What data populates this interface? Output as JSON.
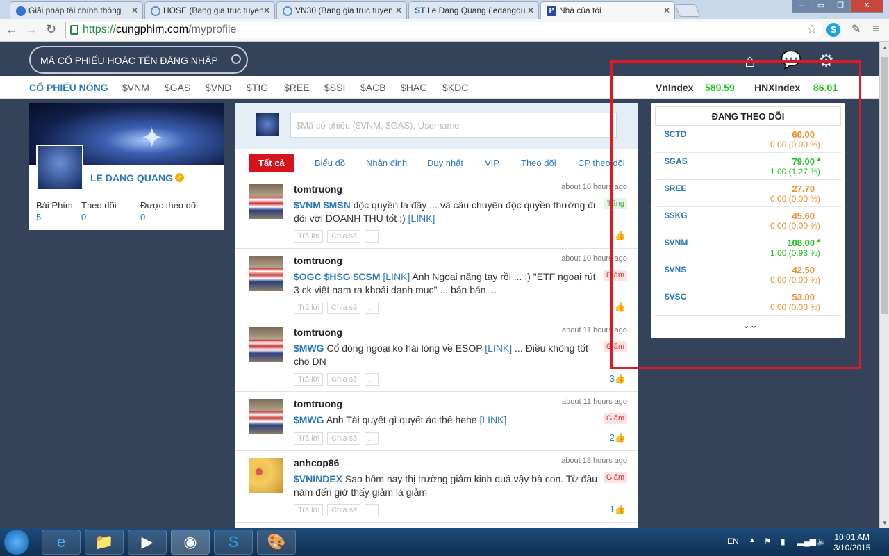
{
  "browser": {
    "tabs": [
      {
        "title": "Giải pháp tài chính thông",
        "icon_color": "#3b6fd6"
      },
      {
        "title": "HOSE (Bang gia truc tuyen",
        "icon_color": "#5a8fd8"
      },
      {
        "title": "VN30 (Bang gia truc tuyen",
        "icon_color": "#5a8fd8"
      },
      {
        "title": "Le Dang Quang (ledangqu",
        "icon_color": "#2a5da8",
        "prefix": "ST"
      },
      {
        "title": "Nhà của tôi",
        "icon_color": "#2a4b9c",
        "prefix": "P"
      }
    ],
    "url_scheme": "https://",
    "url_host": "cungphim.com",
    "url_path": "/myprofile"
  },
  "header": {
    "search_placeholder": "MÃ CỔ PHIẾU HOẶC TÊN ĐĂNG NHẬP",
    "icons": [
      "home-icon",
      "chat-icon",
      "gear-icon"
    ]
  },
  "hot": {
    "label": "CỔ PHIẾU NÓNG",
    "tickers": [
      "$VNM",
      "$GAS",
      "$VND",
      "$TIG",
      "$REE",
      "$SSI",
      "$ACB",
      "$HAG",
      "$KDC"
    ],
    "vnindex_label": "VnIndex",
    "vnindex_value": "589.59",
    "hnx_label": "HNXIndex",
    "hnx_value": "86.01"
  },
  "profile": {
    "name": "LE DANG QUANG",
    "stats": [
      {
        "label": "Bài Phím",
        "value": "5"
      },
      {
        "label": "Theo dõi",
        "value": "0"
      },
      {
        "label": "Được theo dõi",
        "value": "0"
      }
    ]
  },
  "composer": {
    "placeholder": "$Mã cổ phiếu ($VNM, $GAS); Username"
  },
  "filters": [
    "Tất cả",
    "Biểu đồ",
    "Nhận định",
    "Duy nhất",
    "VIP",
    "Theo dõi",
    "CP theo dõi"
  ],
  "post_actions": [
    "Trả lời",
    "Chia sẻ",
    "..."
  ],
  "posts": [
    {
      "user": "tomtruong",
      "time": "about 10 hours ago",
      "tickers": "$VNM $MSN",
      "text": "độc quyền là đây ... và câu chuyện độc quyền thường đi đôi với DOANH THU tốt ;)",
      "link": "[LINK]",
      "suffix": "",
      "badge": "Tăng",
      "likes": "1"
    },
    {
      "user": "tomtruong",
      "time": "about 10 hours ago",
      "tickers": "$OGC $HSG $CSM",
      "text": "",
      "link": "[LINK]",
      "suffix": "Anh Ngoại nặng tay rồi ... ;) \"ETF ngoại rút 3 ck việt nam ra khoải danh mục\" ... bán bán ...",
      "badge": "Giảm",
      "likes": ""
    },
    {
      "user": "tomtruong",
      "time": "about 11 hours ago",
      "tickers": "$MWG",
      "text": "Cổ đông ngoại ko hài lòng về ESOP",
      "link": "[LINK]",
      "suffix": "... Điều không tốt cho DN",
      "badge": "Giảm",
      "likes": "3"
    },
    {
      "user": "tomtruong",
      "time": "about 11 hours ago",
      "tickers": "$MWG",
      "text": "Anh Tài quyết gì quyết ác thế hehe",
      "link": "[LINK]",
      "suffix": "",
      "badge": "Giảm",
      "likes": "2"
    },
    {
      "user": "anhcop86",
      "time": "about 13 hours ago",
      "tickers": "$VNINDEX",
      "text": "Sao hôm nay thị trường giảm kinh quá vậy bà con. Từ đầu năm đến giờ thấy giảm là giảm",
      "link": "",
      "suffix": "",
      "badge": "Giảm",
      "likes": "1"
    }
  ],
  "watchlist": {
    "title": "ĐANG THEO DÕI",
    "rows": [
      {
        "symbol": "$CTD",
        "price": "60.00",
        "change": "0.00 (0.00 %)",
        "arrow": ""
      },
      {
        "symbol": "$GAS",
        "price": "79.00",
        "change": "1.00 (1.27 %)",
        "arrow": "▲"
      },
      {
        "symbol": "$REE",
        "price": "27.70",
        "change": "0.00 (0.00 %)",
        "arrow": ""
      },
      {
        "symbol": "$SKG",
        "price": "45.60",
        "change": "0.00 (0.00 %)",
        "arrow": ""
      },
      {
        "symbol": "$VNM",
        "price": "108.00",
        "change": "1.00 (0.93 %)",
        "arrow": "▲"
      },
      {
        "symbol": "$VNS",
        "price": "42.50",
        "change": "0.00 (0.00 %)",
        "arrow": ""
      },
      {
        "symbol": "$VSC",
        "price": "53.00",
        "change": "0.00 (0.00 %)",
        "arrow": ""
      }
    ],
    "more": "⌄⌄"
  },
  "taskbar": {
    "lang": "EN",
    "time": "10:01 AM",
    "date": "3/10/2015"
  },
  "colors": {
    "accent": "#2a79b8",
    "up": "#19c319",
    "flat": "#f08a24",
    "down_badge": "#d33",
    "highlight_box": "#e01a24"
  }
}
